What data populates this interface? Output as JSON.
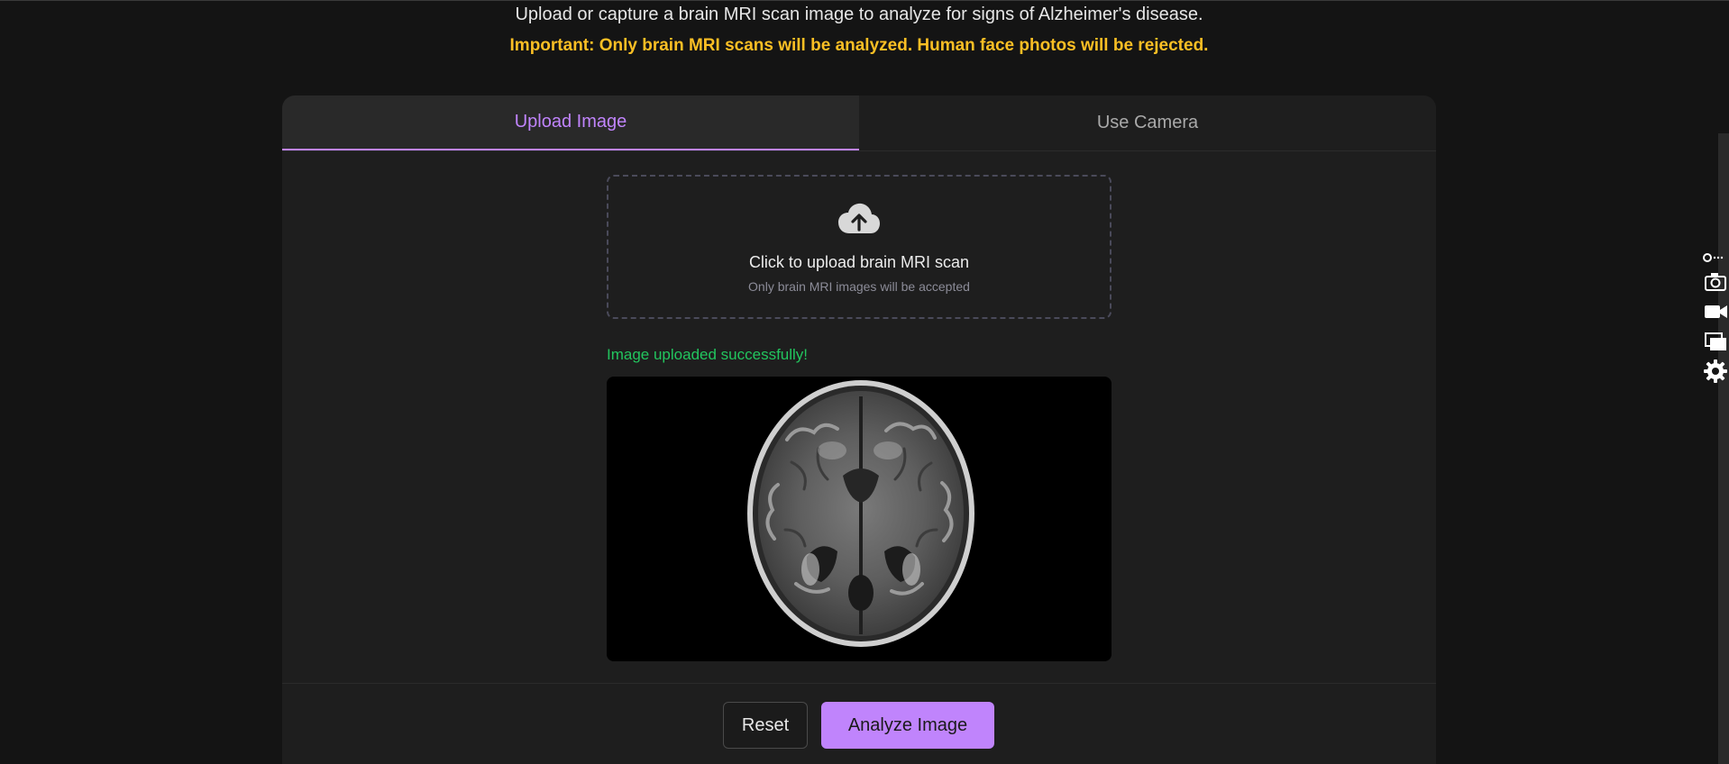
{
  "header": {
    "subtitle": "Upload or capture a brain MRI scan image to analyze for signs of Alzheimer's disease.",
    "warning": "Important: Only brain MRI scans will be analyzed. Human face photos will be rejected."
  },
  "tabs": [
    {
      "label": "Upload Image",
      "active": true
    },
    {
      "label": "Use Camera",
      "active": false
    }
  ],
  "upload": {
    "icon": "cloud-upload-icon",
    "title": "Click to upload brain MRI scan",
    "hint": "Only brain MRI images will be accepted"
  },
  "status": {
    "message": "Image uploaded successfully!"
  },
  "preview": {
    "description": "axial brain MRI scan"
  },
  "actions": {
    "reset_label": "Reset",
    "analyze_label": "Analyze Image"
  },
  "side_toolbar": {
    "icons": [
      "link-icon",
      "camera-icon",
      "video-icon",
      "windows-icon",
      "gear-icon"
    ]
  },
  "colors": {
    "accent": "#c084fc",
    "warning": "#fbbf24",
    "success": "#22c55e",
    "background": "#141414",
    "card": "#1e1e1e"
  }
}
